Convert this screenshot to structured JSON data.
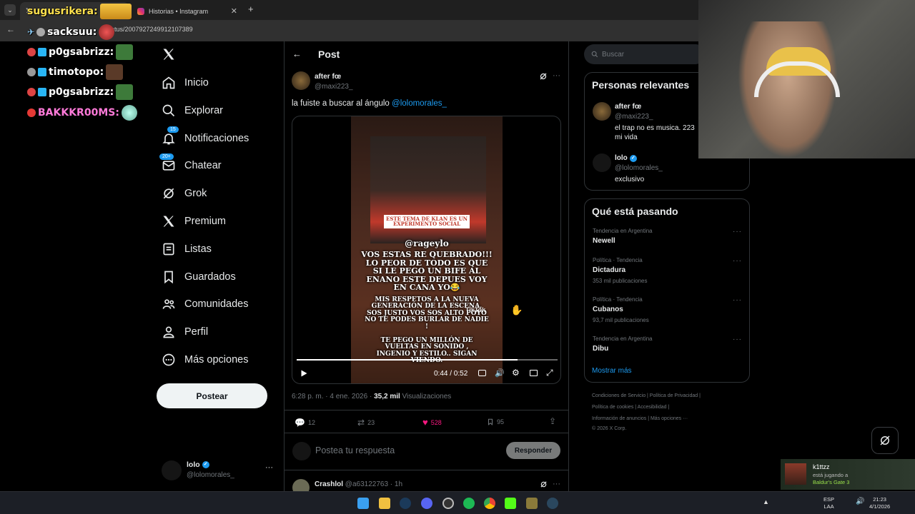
{
  "browser": {
    "tabs": [
      {
        "label": "sugusrikera:",
        "active": true
      },
      {
        "label": "Historias • Instagram",
        "active": false
      }
    ],
    "new_tab": "+",
    "url": "status/2007927249912107389"
  },
  "chat": [
    {
      "user": "sugusrikera:",
      "color": "#ffe14d"
    },
    {
      "user": "sacksuu:",
      "color": "#ffffff"
    },
    {
      "user": "p0gsabrizz:",
      "color": "#ffffff"
    },
    {
      "user": "timotopo:",
      "color": "#ffffff"
    },
    {
      "user": "p0gsabrizz:",
      "color": "#ffffff"
    },
    {
      "user": "BAKKKR00MS:",
      "color": "#ff7ad9"
    }
  ],
  "nav": {
    "items": [
      {
        "label": "Inicio",
        "icon": "home-icon"
      },
      {
        "label": "Explorar",
        "icon": "search-icon"
      },
      {
        "label": "Notificaciones",
        "icon": "bell-icon",
        "badge": "15"
      },
      {
        "label": "Chatear",
        "icon": "mail-icon",
        "badge": "20+"
      },
      {
        "label": "Grok",
        "icon": "grok-icon"
      },
      {
        "label": "Premium",
        "icon": "x-logo-icon"
      },
      {
        "label": "Listas",
        "icon": "list-icon"
      },
      {
        "label": "Guardados",
        "icon": "bookmark-icon"
      },
      {
        "label": "Comunidades",
        "icon": "communities-icon"
      },
      {
        "label": "Perfil",
        "icon": "profile-icon"
      },
      {
        "label": "Más opciones",
        "icon": "more-icon"
      }
    ],
    "post_button": "Postear",
    "account": {
      "name": "lolo",
      "handle": "@lolomorales_",
      "more": "···"
    }
  },
  "post": {
    "header_title": "Post",
    "author_name": "after fœ",
    "author_handle": "@maxi223_",
    "text_prefix": "la fuiste a buscar al ángulo ",
    "text_mention": "@lolomorales_",
    "video": {
      "caption_top": "ESTE TEMA DE KLAN ES UN EXPERIMENTO SOCIAL",
      "mention": "@rageylo",
      "line1": "VOS ESTAS RE QUEBRADO!!! LO PEOR DE TODO ES QUE SI LE PEGO UN BIFE AL ENANO ESTE DEPUES VOY EN CANA YO😂",
      "line2": "MIS RESPETOS A LA NUEVA GENERACIÓN DE LA ESCENA, SOS JUSTO VOS SOS ALTO POYO NO TE PODES BURLAR DE NADIE !",
      "line3": "TE PEGO UN MILLÓN DE VUELTAS EN SONIDO , INGENIO Y ESTILO.. SIGAN VIENDO.",
      "watermark": "TikTok",
      "time": "0:44 / 0:52",
      "progress": 0.846
    },
    "timestamp": "6:28 p. m. · 4 ene. 2026 · ",
    "views_count": "35,2 mil",
    "views_label": " Visualizaciones",
    "stats": {
      "replies": "12",
      "reposts": "23",
      "likes": "528",
      "bookmarks": "95"
    },
    "reply_placeholder": "Postea tu respuesta",
    "reply_button": "Responder",
    "next_reply": {
      "name": "Crashlol",
      "handle": "@a63122763 · 1h"
    }
  },
  "right": {
    "search_placeholder": "Buscar",
    "relevant_title": "Personas relevantes",
    "people": [
      {
        "name": "after fœ",
        "handle": "@maxi223_",
        "bio": "el trap no es musica. 223 mi vida",
        "verified": false
      },
      {
        "name": "lolo",
        "handle": "@lolomorales_",
        "bio": "exclusivo",
        "verified": true
      }
    ],
    "trending_title": "Qué está pasando",
    "trends": [
      {
        "category": "Tendencia en Argentina",
        "name": "Newell",
        "count": ""
      },
      {
        "category": "Política · Tendencia",
        "name": "Dictadura",
        "count": "353 mil publicaciones"
      },
      {
        "category": "Política · Tendencia",
        "name": "Cubanos",
        "count": "93,7 mil publicaciones"
      },
      {
        "category": "Tendencia en Argentina",
        "name": "Dibu",
        "count": ""
      }
    ],
    "show_more": "Mostrar más",
    "footer": {
      "row1": "Condiciones de Servicio  |   Política de Privacidad  |",
      "row2": "Política de cookies  |   Accesibilidad  |",
      "row3": "Información de anuncios  |   Más opciones ···",
      "row4": "© 2026 X Corp."
    }
  },
  "steam_toast": {
    "user": "k1ttzz",
    "line1": "está jugando a",
    "game": "Baldur's Gate 3"
  },
  "taskbar": {
    "lang1": "ESP",
    "lang2": "LAA",
    "time": "21:23",
    "date": "4/1/2026"
  }
}
